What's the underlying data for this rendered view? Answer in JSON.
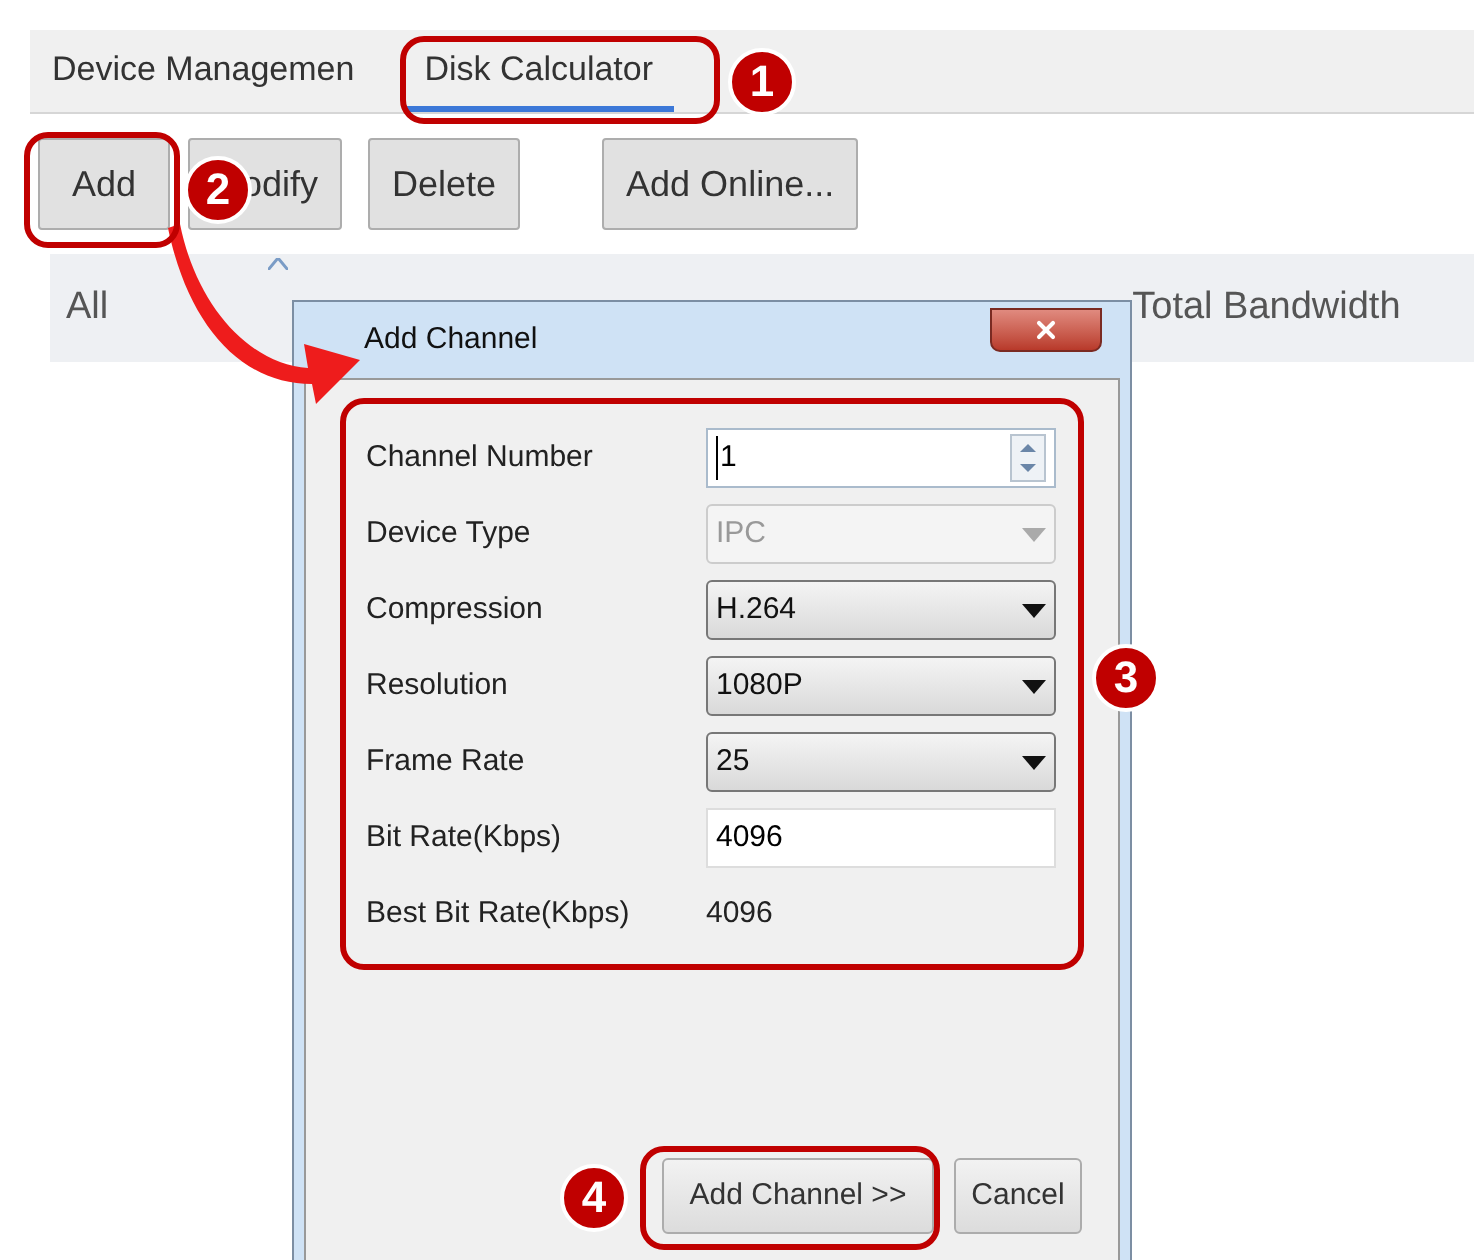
{
  "tabs": [
    {
      "label": "Device Managemen",
      "selected": false
    },
    {
      "label": "Disk Calculator",
      "selected": true
    }
  ],
  "toolbar": [
    {
      "label": "Add"
    },
    {
      "label": "odify"
    },
    {
      "label": "Delete"
    },
    {
      "label": "Add Online..."
    }
  ],
  "table": {
    "columns": [
      "All",
      "Total Bandwidth"
    ]
  },
  "dialog": {
    "title": "Add Channel",
    "fields": [
      {
        "kind": "spin",
        "label": "Channel Number",
        "value": "1"
      },
      {
        "kind": "select",
        "label": "Device Type",
        "value": "IPC",
        "disabled": true
      },
      {
        "kind": "select",
        "label": "Compression",
        "value": "H.264",
        "disabled": false
      },
      {
        "kind": "select",
        "label": "Resolution",
        "value": "1080P",
        "disabled": false
      },
      {
        "kind": "select",
        "label": "Frame Rate",
        "value": "25",
        "disabled": false
      },
      {
        "kind": "input",
        "label": "Bit Rate(Kbps)",
        "value": "4096"
      },
      {
        "kind": "text",
        "label": "Best Bit Rate(Kbps)",
        "value": "4096"
      }
    ],
    "buttons": [
      "Add Channel >>",
      "Cancel"
    ]
  },
  "callouts": [
    "1",
    "2",
    "3",
    "4"
  ]
}
